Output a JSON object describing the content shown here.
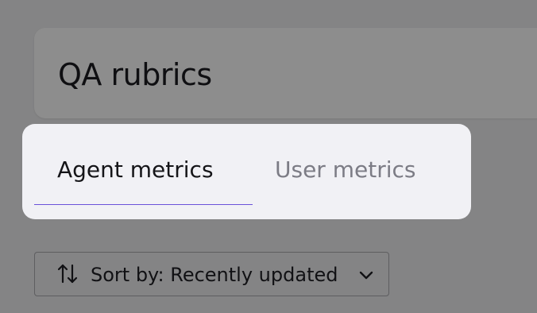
{
  "header": {
    "title": "QA rubrics"
  },
  "tabs": [
    {
      "label": "Agent metrics",
      "active": true
    },
    {
      "label": "User metrics",
      "active": false
    }
  ],
  "sort": {
    "label": "Sort by: Recently updated",
    "icon": "sort-arrows-icon",
    "dropdown_icon": "chevron-down-icon"
  },
  "colors": {
    "accent": "#6a52d9",
    "active_tab_text": "#151518",
    "inactive_tab_text": "#7c7c85"
  }
}
